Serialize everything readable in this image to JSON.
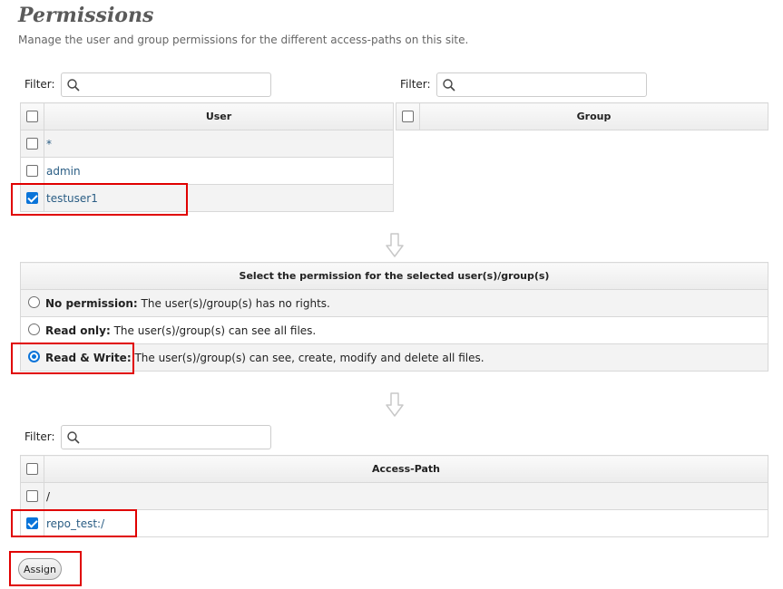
{
  "header": {
    "title": "Permissions",
    "description": "Manage the user and group permissions for the different access-paths on this site."
  },
  "filter_label": "Filter:",
  "users_table": {
    "header": "User",
    "rows": [
      {
        "name": "*",
        "checked": false
      },
      {
        "name": "admin",
        "checked": false
      },
      {
        "name": "testuser1",
        "checked": true
      }
    ]
  },
  "groups_table": {
    "header": "Group",
    "rows": []
  },
  "permission_table": {
    "header": "Select the permission for the selected user(s)/group(s)",
    "options": [
      {
        "label": "No permission:",
        "text": "The user(s)/group(s) has no rights.",
        "selected": false
      },
      {
        "label": "Read only:",
        "text": "The user(s)/group(s) can see all files.",
        "selected": false
      },
      {
        "label": "Read & Write:",
        "text": "The user(s)/group(s) can see, create, modify and delete all files.",
        "selected": true
      }
    ]
  },
  "paths_table": {
    "header": "Access-Path",
    "rows": [
      {
        "name": "/",
        "checked": false
      },
      {
        "name": "repo_test:/",
        "checked": true
      }
    ]
  },
  "assign_button": "Assign",
  "colors": {
    "accent": "#0a74d9",
    "link": "#2a5d84",
    "highlight": "#e00000"
  }
}
